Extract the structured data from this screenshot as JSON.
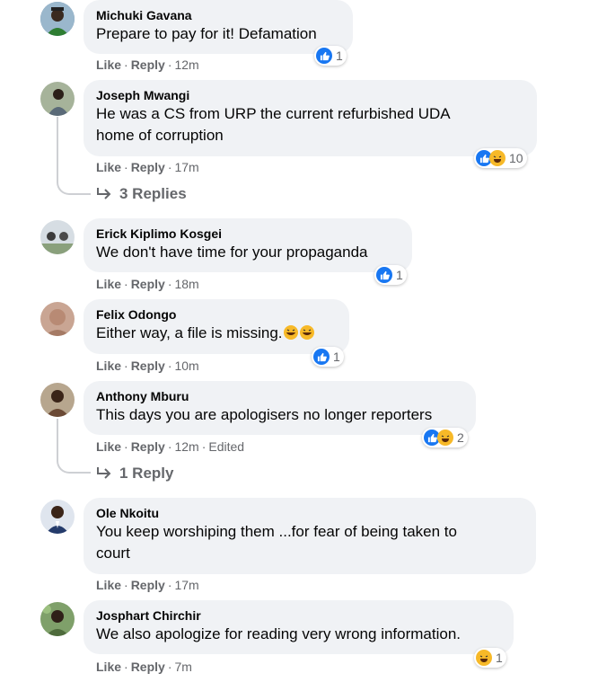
{
  "actions": {
    "like": "Like",
    "reply": "Reply"
  },
  "colors": {
    "like_blue": "#1877f2",
    "haha_yellow": "#f7b928",
    "bubble_bg": "#f0f2f5",
    "meta_gray": "#65676b"
  },
  "comments": [
    {
      "author": "Michuki Gavana",
      "text": "Prepare to pay for it! Defamation",
      "time": "12m",
      "reaction_count": "1",
      "reactions": [
        "like-icon"
      ]
    },
    {
      "author": "Joseph Mwangi",
      "text_line1": "He was a CS from URP the current refurbished UDA",
      "text_line2": "home of corruption",
      "time": "17m",
      "reaction_count": "10",
      "reactions": [
        "like-icon",
        "haha-icon"
      ],
      "replies": "3 Replies"
    },
    {
      "author": "Erick Kiplimo Kosgei",
      "text": "We don't have time for your propaganda",
      "time": "18m",
      "reaction_count": "1",
      "reactions": [
        "like-icon"
      ]
    },
    {
      "author": "Felix Odongo",
      "text": "Either way, a file is missing.",
      "time": "10m",
      "reaction_count": "1",
      "reactions": [
        "like-icon"
      ]
    },
    {
      "author": "Anthony Mburu",
      "text": "This days you are apologisers no longer reporters",
      "time": "12m",
      "edited": "Edited",
      "reaction_count": "2",
      "reactions": [
        "like-icon",
        "haha-icon"
      ],
      "replies": "1 Reply"
    },
    {
      "author": "Ole Nkoitu",
      "text_line1": "You keep worshiping them ...for fear of being taken to",
      "text_line2": "court",
      "time": "17m"
    },
    {
      "author": "Josphart Chirchir",
      "text": "We also apologize for reading very wrong information.",
      "time": "7m",
      "reaction_count": "1",
      "reactions": [
        "haha-icon"
      ]
    }
  ]
}
